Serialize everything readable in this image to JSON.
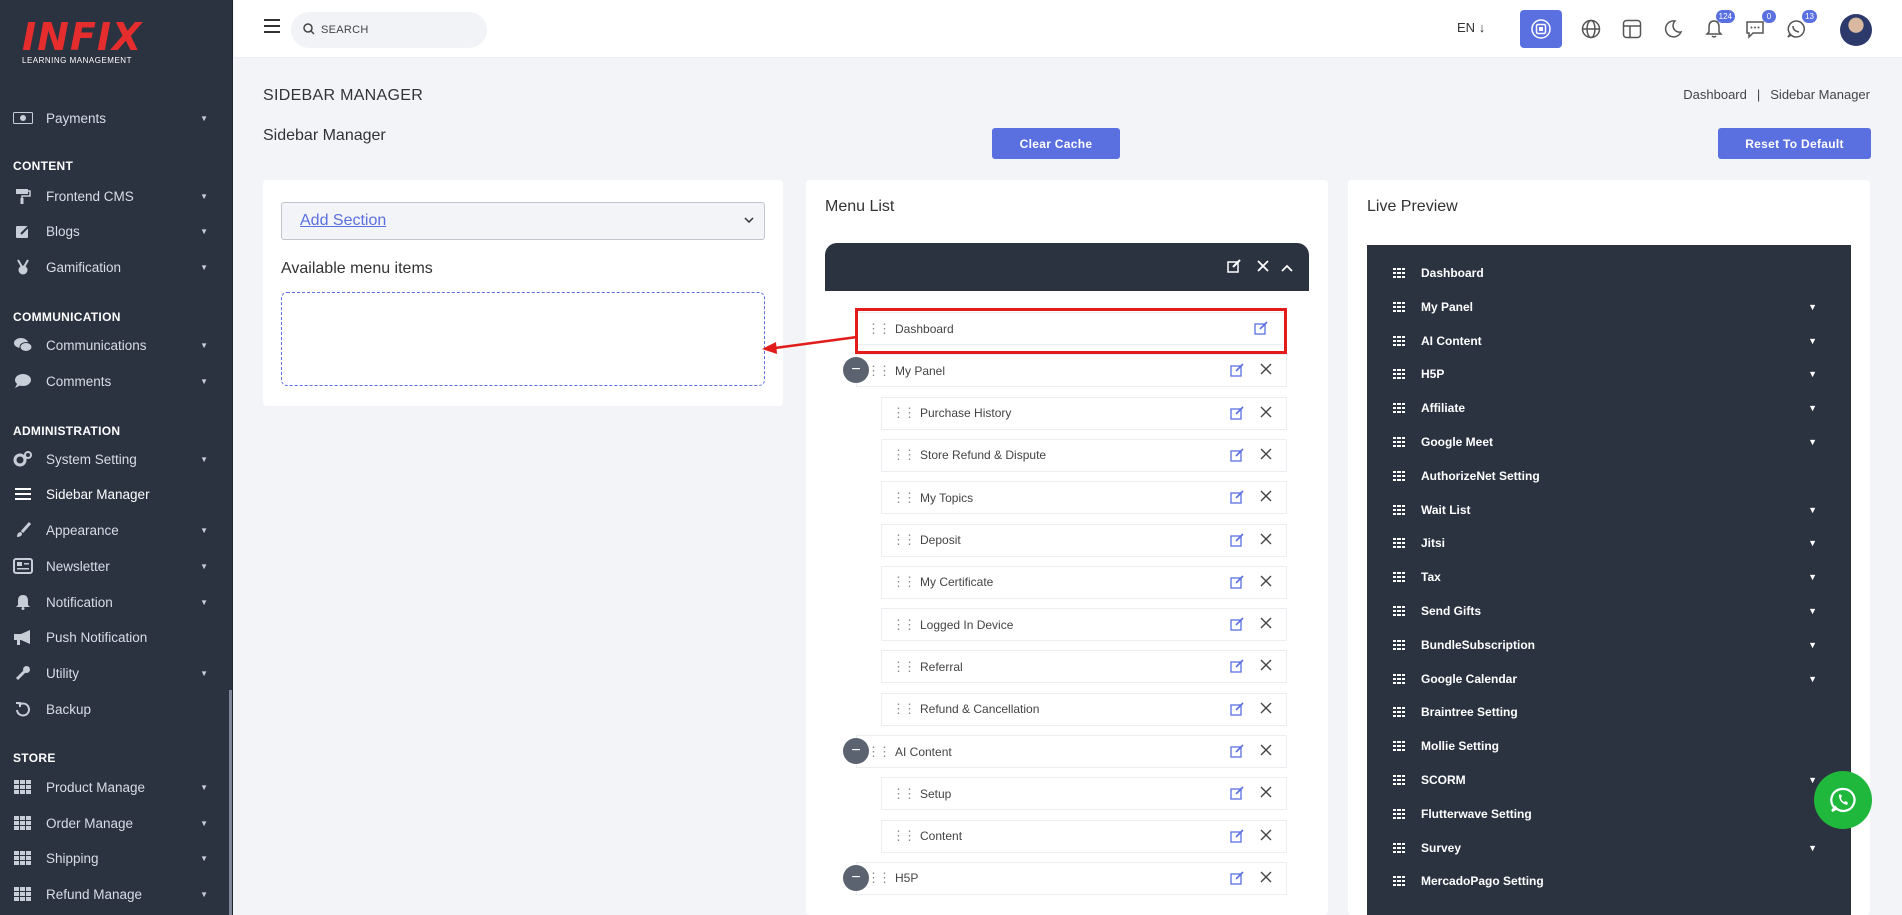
{
  "sidebar": {
    "logo_main": "INFIX",
    "logo_sub": "LEARNING MANAGEMENT",
    "sections": [
      {
        "title": "CONTENT"
      },
      {
        "title": "COMMUNICATION"
      },
      {
        "title": "ADMINISTRATION"
      },
      {
        "title": "STORE"
      }
    ],
    "items": [
      {
        "label": "Payments",
        "icon": "money-icon"
      },
      {
        "label": "Frontend CMS",
        "icon": "paint-roller-icon"
      },
      {
        "label": "Blogs",
        "icon": "edit-square-icon"
      },
      {
        "label": "Gamification",
        "icon": "medal-icon"
      },
      {
        "label": "Communications",
        "icon": "comments-icon"
      },
      {
        "label": "Comments",
        "icon": "comment-icon"
      },
      {
        "label": "System Setting",
        "icon": "gears-icon"
      },
      {
        "label": "Sidebar Manager",
        "icon": "bars-icon"
      },
      {
        "label": "Appearance",
        "icon": "brush-icon"
      },
      {
        "label": "Newsletter",
        "icon": "newspaper-icon"
      },
      {
        "label": "Notification",
        "icon": "bell-icon"
      },
      {
        "label": "Push Notification",
        "icon": "megaphone-icon"
      },
      {
        "label": "Utility",
        "icon": "wrench-icon"
      },
      {
        "label": "Backup",
        "icon": "undo-icon"
      },
      {
        "label": "Product Manage",
        "icon": "grid-icon"
      },
      {
        "label": "Order Manage",
        "icon": "grid-icon"
      },
      {
        "label": "Shipping",
        "icon": "grid-icon"
      },
      {
        "label": "Refund Manage",
        "icon": "grid-icon"
      }
    ]
  },
  "header": {
    "search_placeholder": "SEARCH",
    "language": "EN",
    "badges": {
      "notifications": "124",
      "messages": "0",
      "whatsapp": "13"
    }
  },
  "page": {
    "title": "SIDEBAR MANAGER",
    "breadcrumb": [
      "Dashboard",
      "Sidebar Manager"
    ],
    "breadcrumb_sep": "|",
    "subtitle": "Sidebar Manager",
    "clear_cache": "Clear Cache",
    "reset_default": "Reset To Default"
  },
  "available": {
    "select_value": "Add Section",
    "title": "Available menu items"
  },
  "menu_list": {
    "title": "Menu List",
    "rows": [
      {
        "label": "Dashboard",
        "level": 0,
        "collapsible": false,
        "closable": false,
        "highlighted": true
      },
      {
        "label": "My Panel",
        "level": 0,
        "collapsible": true,
        "closable": true
      },
      {
        "label": "Purchase History",
        "level": 1,
        "closable": true
      },
      {
        "label": "Store Refund & Dispute",
        "level": 1,
        "closable": true
      },
      {
        "label": "My Topics",
        "level": 1,
        "closable": true
      },
      {
        "label": "Deposit",
        "level": 1,
        "closable": true
      },
      {
        "label": "My Certificate",
        "level": 1,
        "closable": true
      },
      {
        "label": "Logged In Device",
        "level": 1,
        "closable": true
      },
      {
        "label": "Referral",
        "level": 1,
        "closable": true
      },
      {
        "label": "Refund & Cancellation",
        "level": 1,
        "closable": true
      },
      {
        "label": "AI Content",
        "level": 0,
        "collapsible": true,
        "closable": true
      },
      {
        "label": "Setup",
        "level": 1,
        "closable": true
      },
      {
        "label": "Content",
        "level": 1,
        "closable": true
      },
      {
        "label": "H5P",
        "level": 0,
        "collapsible": true,
        "closable": true
      }
    ]
  },
  "live_preview": {
    "title": "Live Preview",
    "items": [
      {
        "label": "Dashboard",
        "caret": false
      },
      {
        "label": "My Panel",
        "caret": true
      },
      {
        "label": "AI Content",
        "caret": true
      },
      {
        "label": "H5P",
        "caret": true
      },
      {
        "label": "Affiliate",
        "caret": true
      },
      {
        "label": "Google Meet",
        "caret": true
      },
      {
        "label": "AuthorizeNet Setting",
        "caret": false
      },
      {
        "label": "Wait List",
        "caret": true
      },
      {
        "label": "Jitsi",
        "caret": true
      },
      {
        "label": "Tax",
        "caret": true
      },
      {
        "label": "Send Gifts",
        "caret": true
      },
      {
        "label": "BundleSubscription",
        "caret": true
      },
      {
        "label": "Google Calendar",
        "caret": true
      },
      {
        "label": "Braintree Setting",
        "caret": false
      },
      {
        "label": "Mollie Setting",
        "caret": false
      },
      {
        "label": "SCORM",
        "caret": true
      },
      {
        "label": "Flutterwave Setting",
        "caret": false
      },
      {
        "label": "Survey",
        "caret": true
      },
      {
        "label": "MercadoPago Setting",
        "caret": false
      }
    ]
  },
  "colors": {
    "accent": "#5a6fe0",
    "sidebar_bg": "#2b3240",
    "highlight": "#e21b1b",
    "whatsapp": "#1fb83d"
  }
}
